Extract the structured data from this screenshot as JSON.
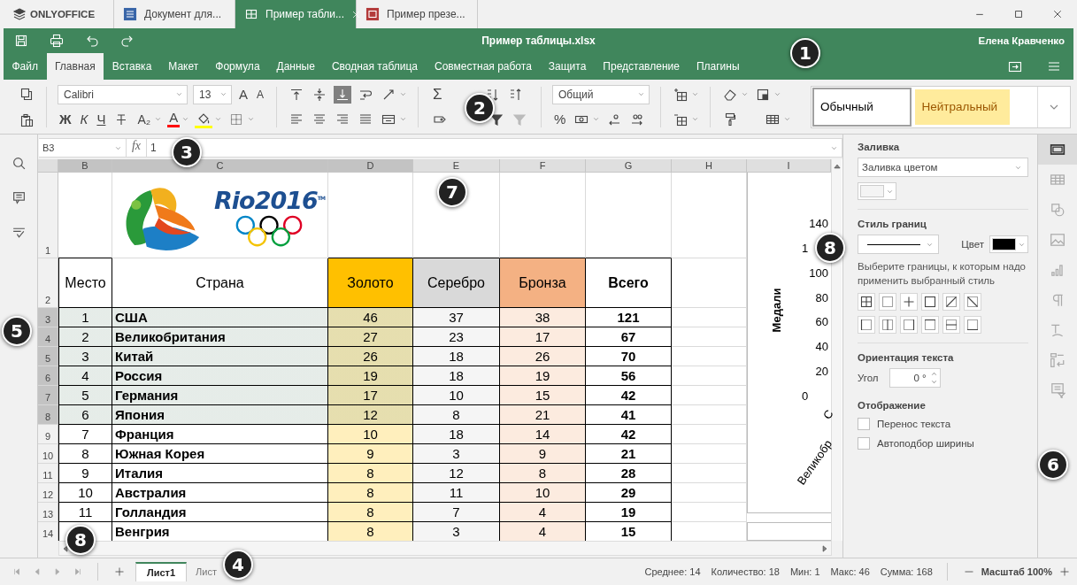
{
  "app": {
    "brand": "ONLYOFFICE"
  },
  "window_tabs": [
    {
      "label": "Документ для...",
      "kind": "document",
      "selected": false
    },
    {
      "label": "Пример табли...",
      "kind": "spreadsheet",
      "selected": true
    },
    {
      "label": "Пример презе...",
      "kind": "presentation",
      "selected": false
    }
  ],
  "header": {
    "title": "Пример таблицы.xlsx",
    "user": "Елена Кравченко"
  },
  "menu": [
    {
      "label": "Файл",
      "selected": false
    },
    {
      "label": "Главная",
      "selected": true
    },
    {
      "label": "Вставка",
      "selected": false
    },
    {
      "label": "Макет",
      "selected": false
    },
    {
      "label": "Формула",
      "selected": false
    },
    {
      "label": "Данные",
      "selected": false
    },
    {
      "label": "Сводная таблица",
      "selected": false
    },
    {
      "label": "Совместная работа",
      "selected": false
    },
    {
      "label": "Защита",
      "selected": false
    },
    {
      "label": "Представление",
      "selected": false
    },
    {
      "label": "Плагины",
      "selected": false
    }
  ],
  "toolbar": {
    "font": "Calibri",
    "font_size": "13",
    "size_buttons": [
      {
        "kind": "grow",
        "label": "A"
      },
      {
        "kind": "shrink",
        "label": "A"
      }
    ],
    "text_buttons": [
      {
        "kind": "bold",
        "label": "Ж"
      },
      {
        "kind": "italic",
        "label": "К"
      },
      {
        "kind": "underline",
        "label": "Ч"
      },
      {
        "kind": "strike"
      },
      {
        "kind": "subscript",
        "label": "A₂"
      },
      {
        "kind": "font_color",
        "label": "A",
        "color": "#ff0000"
      },
      {
        "kind": "fill_color",
        "color": "#ffff00"
      },
      {
        "kind": "borders"
      }
    ],
    "vertical_align": [
      {
        "selected": false
      },
      {
        "selected": false
      },
      {
        "selected": true
      }
    ],
    "sum": "Σ",
    "number_format": "Общий",
    "percent": "%",
    "styles": [
      {
        "label": "Обычный",
        "kind": "normal",
        "selected": true
      },
      {
        "label": "Нейтральный",
        "kind": "neutral",
        "selected": false
      }
    ]
  },
  "formula_bar": {
    "cell": "B3",
    "fx": "fx",
    "value": "1"
  },
  "sheet": {
    "logo_text": "Rio2016",
    "logo_mark": "TM",
    "columns": [
      {
        "letter": "B",
        "kind": "place",
        "header": "Место",
        "selected": true
      },
      {
        "letter": "C",
        "kind": "country",
        "header": "Страна",
        "selected": true
      },
      {
        "letter": "D",
        "kind": "medal",
        "header": "Золото",
        "color": "#ffc000",
        "selected": true
      },
      {
        "letter": "E",
        "kind": "medal",
        "header": "Серебро",
        "color": "#d9d9d9",
        "selected": false
      },
      {
        "letter": "F",
        "kind": "medal",
        "header": "Бронза",
        "color": "#f4b183",
        "selected": false
      },
      {
        "letter": "G",
        "kind": "total",
        "header": "Всего",
        "selected": false
      },
      {
        "letter": "H",
        "kind": "empty",
        "selected": false
      }
    ],
    "header_rows": [
      "1",
      "2"
    ],
    "rows": [
      {
        "number": "3",
        "place": "1",
        "values": [
          "США",
          "46",
          "37",
          "38",
          "121"
        ],
        "selected": true
      },
      {
        "number": "4",
        "place": "2",
        "values": [
          "Великобритания",
          "27",
          "23",
          "17",
          "67"
        ],
        "selected": true
      },
      {
        "number": "5",
        "place": "3",
        "values": [
          "Китай",
          "26",
          "18",
          "26",
          "70"
        ],
        "selected": true
      },
      {
        "number": "6",
        "place": "4",
        "values": [
          "Россия",
          "19",
          "18",
          "19",
          "56"
        ],
        "selected": true
      },
      {
        "number": "7",
        "place": "5",
        "values": [
          "Германия",
          "17",
          "10",
          "15",
          "42"
        ],
        "selected": true
      },
      {
        "number": "8",
        "place": "6",
        "values": [
          "Япония",
          "12",
          "8",
          "21",
          "41"
        ],
        "selected": true
      },
      {
        "number": "9",
        "place": "7",
        "values": [
          "Франция",
          "10",
          "18",
          "14",
          "42"
        ],
        "selected": false
      },
      {
        "number": "10",
        "place": "8",
        "values": [
          "Южная Корея",
          "9",
          "3",
          "9",
          "21"
        ],
        "selected": false
      },
      {
        "number": "11",
        "place": "9",
        "values": [
          "Италия",
          "8",
          "12",
          "8",
          "28"
        ],
        "selected": false
      },
      {
        "number": "12",
        "place": "10",
        "values": [
          "Австралия",
          "8",
          "11",
          "10",
          "29"
        ],
        "selected": false
      },
      {
        "number": "13",
        "place": "11",
        "values": [
          "Голландия",
          "8",
          "7",
          "4",
          "19"
        ],
        "selected": false
      },
      {
        "number": "14",
        "values": [
          "Венгрия",
          "8",
          "3",
          "4",
          "15"
        ],
        "selected": false
      }
    ],
    "chart": {
      "column": "I",
      "axis_title": "Медали",
      "y_ticks": [
        "140",
        "1",
        "100",
        "80",
        "60",
        "40",
        "20",
        "0"
      ],
      "category_labels": [
        "Великобр",
        "С"
      ]
    }
  },
  "format_panel": {
    "fill_title": "Заливка",
    "fill_type": "Заливка цветом",
    "border_title": "Стиль границ",
    "color_label": "Цвет",
    "hint": "Выберите границы, к которым надо применить выбранный стиль",
    "orientation_title": "Ориентация текста",
    "angle_label": "Угол",
    "angle": "0 °",
    "display_title": "Отображение",
    "options": [
      {
        "label": "Перенос текста",
        "checked": false
      },
      {
        "label": "Автоподбор ширины",
        "checked": false
      }
    ]
  },
  "side_tabs": [
    {
      "selected": true
    },
    {
      "selected": false
    },
    {
      "selected": false
    },
    {
      "selected": false
    },
    {
      "selected": false
    },
    {
      "selected": false
    },
    {
      "selected": false
    },
    {
      "selected": false
    },
    {
      "selected": false
    }
  ],
  "sheet_tabs": [
    {
      "label": "Лист1",
      "selected": true
    },
    {
      "label": "Лист",
      "selected": false
    }
  ],
  "status": [
    "Среднее: 14",
    "Количество: 18",
    "Мин: 1",
    "Макс: 46",
    "Сумма: 168"
  ],
  "zoom": {
    "label": "Масштаб 100%"
  },
  "callouts": [
    {
      "number": "1"
    },
    {
      "number": "2"
    },
    {
      "number": "3"
    },
    {
      "number": "7"
    },
    {
      "number": "8"
    },
    {
      "number": "5"
    },
    {
      "number": "6"
    },
    {
      "number": "8"
    },
    {
      "number": "4"
    }
  ]
}
